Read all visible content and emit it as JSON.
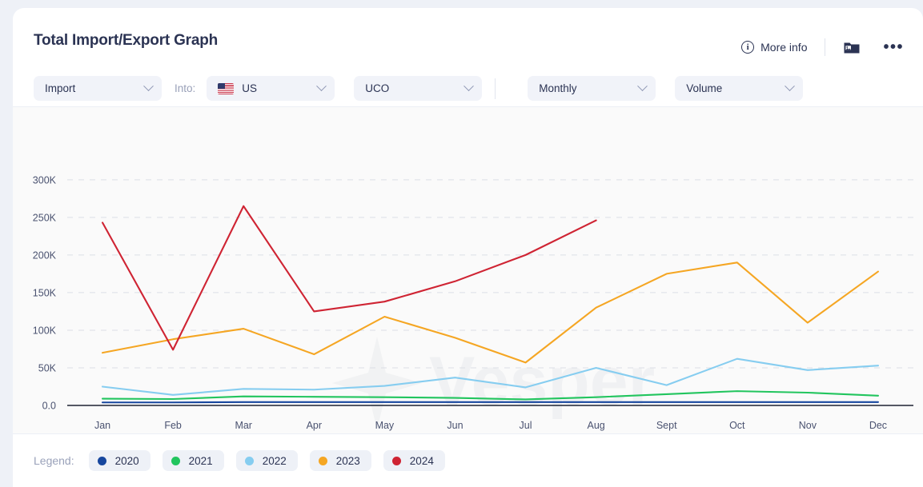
{
  "header": {
    "title": "Total Import/Export Graph",
    "more_info_label": "More info",
    "info_icon": "info-circle-icon",
    "image_icon": "image-folder-icon",
    "more_menu_icon": "ellipsis-icon"
  },
  "controls": {
    "direction": {
      "value": "Import",
      "icon": "chevron-down-icon"
    },
    "into_label": "Into:",
    "country": {
      "value": "US",
      "flag": "us-flag-icon",
      "icon": "chevron-down-icon"
    },
    "product": {
      "value": "UCO",
      "icon": "chevron-down-icon"
    },
    "frequency": {
      "value": "Monthly",
      "icon": "chevron-down-icon"
    },
    "unit": {
      "value": "Volume",
      "icon": "chevron-down-icon"
    }
  },
  "watermark": "Vesper",
  "legend": {
    "label": "Legend:",
    "items": [
      {
        "name": "2020",
        "color": "#17479e"
      },
      {
        "name": "2021",
        "color": "#22c55e"
      },
      {
        "name": "2022",
        "color": "#86cdf0"
      },
      {
        "name": "2023",
        "color": "#f5a623"
      },
      {
        "name": "2024",
        "color": "#cf2433"
      }
    ]
  },
  "chart_data": {
    "type": "line",
    "title": "Total Import/Export Graph",
    "xlabel": "",
    "ylabel": "Volume",
    "categories": [
      "Jan",
      "Feb",
      "Mar",
      "Apr",
      "May",
      "Jun",
      "Jul",
      "Aug",
      "Sept",
      "Oct",
      "Nov",
      "Dec"
    ],
    "ytick_labels": [
      "0.0",
      "50K",
      "100K",
      "150K",
      "200K",
      "250K",
      "300K"
    ],
    "ytick_values": [
      0,
      50000,
      100000,
      150000,
      200000,
      250000,
      300000
    ],
    "ylim": [
      0,
      320000
    ],
    "grid": true,
    "legend_position": "bottom",
    "series": [
      {
        "name": "2020",
        "color": "#17479e",
        "values": [
          4000,
          4000,
          4500,
          4500,
          4500,
          4500,
          4500,
          4500,
          4500,
          4500,
          4500,
          4500
        ]
      },
      {
        "name": "2021",
        "color": "#22c55e",
        "values": [
          9000,
          8500,
          12000,
          11500,
          11000,
          10000,
          8000,
          11000,
          15000,
          19000,
          17000,
          13000
        ]
      },
      {
        "name": "2022",
        "color": "#86cdf0",
        "values": [
          25000,
          14000,
          22000,
          21000,
          26000,
          37000,
          24000,
          50000,
          27000,
          62000,
          47000,
          53000
        ]
      },
      {
        "name": "2023",
        "color": "#f5a623",
        "values": [
          70000,
          88000,
          102000,
          68000,
          118000,
          90000,
          57000,
          130000,
          175000,
          190000,
          110000,
          178000
        ]
      },
      {
        "name": "2024",
        "color": "#cf2433",
        "values": [
          243000,
          74000,
          265000,
          125000,
          138000,
          165000,
          200000,
          246000,
          null,
          null,
          null,
          null
        ]
      }
    ]
  }
}
